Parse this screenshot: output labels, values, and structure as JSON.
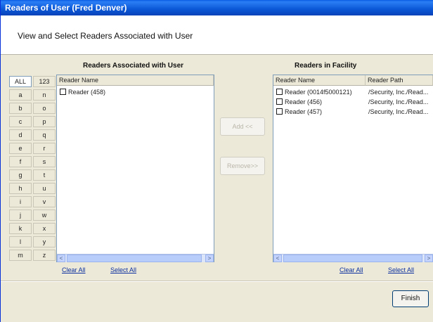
{
  "window": {
    "title": "Readers of User (Fred Denver)"
  },
  "header": {
    "text": "View and Select Readers Associated with User"
  },
  "left_panel": {
    "title": "Readers Associated with User",
    "column": "Reader Name",
    "rows": [
      "Reader (458)"
    ],
    "clear_all": "Clear All",
    "select_all": "Select All"
  },
  "alphabet": {
    "left": [
      "ALL",
      "a",
      "b",
      "c",
      "d",
      "e",
      "f",
      "g",
      "h",
      "i",
      "j",
      "k",
      "l",
      "m"
    ],
    "right": [
      "123",
      "n",
      "o",
      "p",
      "q",
      "r",
      "s",
      "t",
      "u",
      "v",
      "w",
      "x",
      "y",
      "z"
    ]
  },
  "middle": {
    "add": "Add   <<",
    "remove": "Remove>>"
  },
  "right_panel": {
    "title": "Readers in Facility",
    "columns": [
      "Reader Name",
      "Reader Path"
    ],
    "rows": [
      {
        "name": "Reader (0014f5000121)",
        "path": "/Security, Inc./Read..."
      },
      {
        "name": "Reader (456)",
        "path": "/Security, Inc./Read..."
      },
      {
        "name": "Reader (457)",
        "path": "/Security, Inc./Read..."
      }
    ],
    "clear_all": "Clear All",
    "select_all": "Select All"
  },
  "footer": {
    "finish": "Finish"
  },
  "scroll_glyphs": {
    "left": "<",
    "right": ">"
  }
}
